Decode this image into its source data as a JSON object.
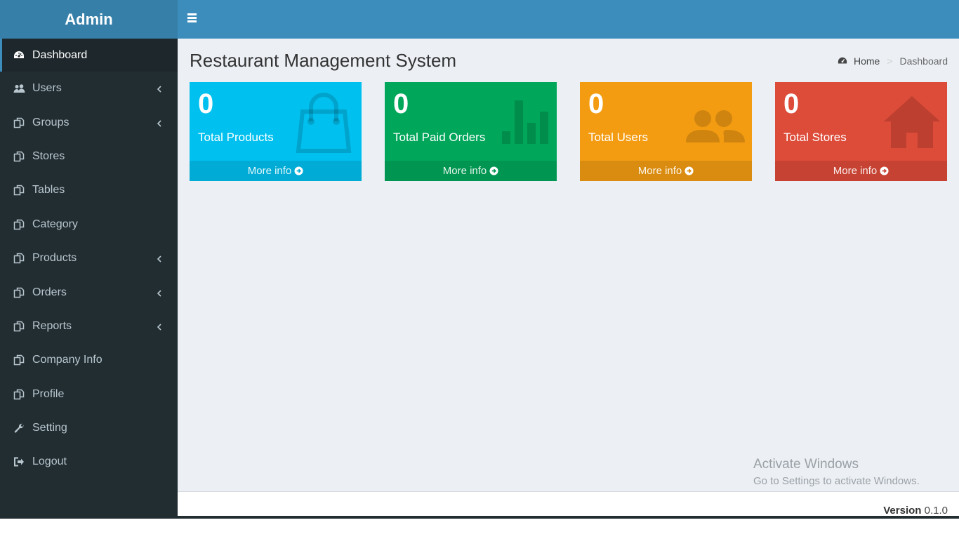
{
  "header": {
    "logo_text": "Admin"
  },
  "sidebar": {
    "items": [
      {
        "label": "Dashboard",
        "icon": "dashboard-icon",
        "active": true,
        "has_children": false
      },
      {
        "label": "Users",
        "icon": "users-icon",
        "has_children": true
      },
      {
        "label": "Groups",
        "icon": "copy-icon",
        "has_children": true
      },
      {
        "label": "Stores",
        "icon": "copy-icon",
        "has_children": false
      },
      {
        "label": "Tables",
        "icon": "copy-icon",
        "has_children": false
      },
      {
        "label": "Category",
        "icon": "copy-icon",
        "has_children": false
      },
      {
        "label": "Products",
        "icon": "copy-icon",
        "has_children": true
      },
      {
        "label": "Orders",
        "icon": "copy-icon",
        "has_children": true
      },
      {
        "label": "Reports",
        "icon": "copy-icon",
        "has_children": true
      },
      {
        "label": "Company Info",
        "icon": "copy-icon",
        "has_children": false
      },
      {
        "label": "Profile",
        "icon": "copy-icon",
        "has_children": false
      },
      {
        "label": "Setting",
        "icon": "wrench-icon",
        "has_children": false
      },
      {
        "label": "Logout",
        "icon": "sign-out-icon",
        "has_children": false
      }
    ]
  },
  "content": {
    "title": "Restaurant Management System",
    "breadcrumb": {
      "home": "Home",
      "separator": ">",
      "current": "Dashboard"
    }
  },
  "boxes": [
    {
      "value": "0",
      "label": "Total Products",
      "link": "More info",
      "color": "#00c0ef",
      "icon": "shopping-bag-icon"
    },
    {
      "value": "0",
      "label": "Total Paid Orders",
      "link": "More info",
      "color": "#00a65a",
      "icon": "bar-chart-icon"
    },
    {
      "value": "0",
      "label": "Total Users",
      "link": "More info",
      "color": "#f39c12",
      "icon": "users-icon"
    },
    {
      "value": "0",
      "label": "Total Stores",
      "link": "More info",
      "color": "#dd4b39",
      "icon": "home-icon"
    }
  ],
  "watermark": {
    "line1": "Activate Windows",
    "line2": "Go to Settings to activate Windows."
  },
  "footer": {
    "version_label": "Version",
    "version": "0.1.0"
  },
  "colors": {
    "header": "#3c8dbc",
    "logo_bg": "#367fa9",
    "sidebar": "#222d32",
    "content_bg": "#ecf0f5"
  }
}
